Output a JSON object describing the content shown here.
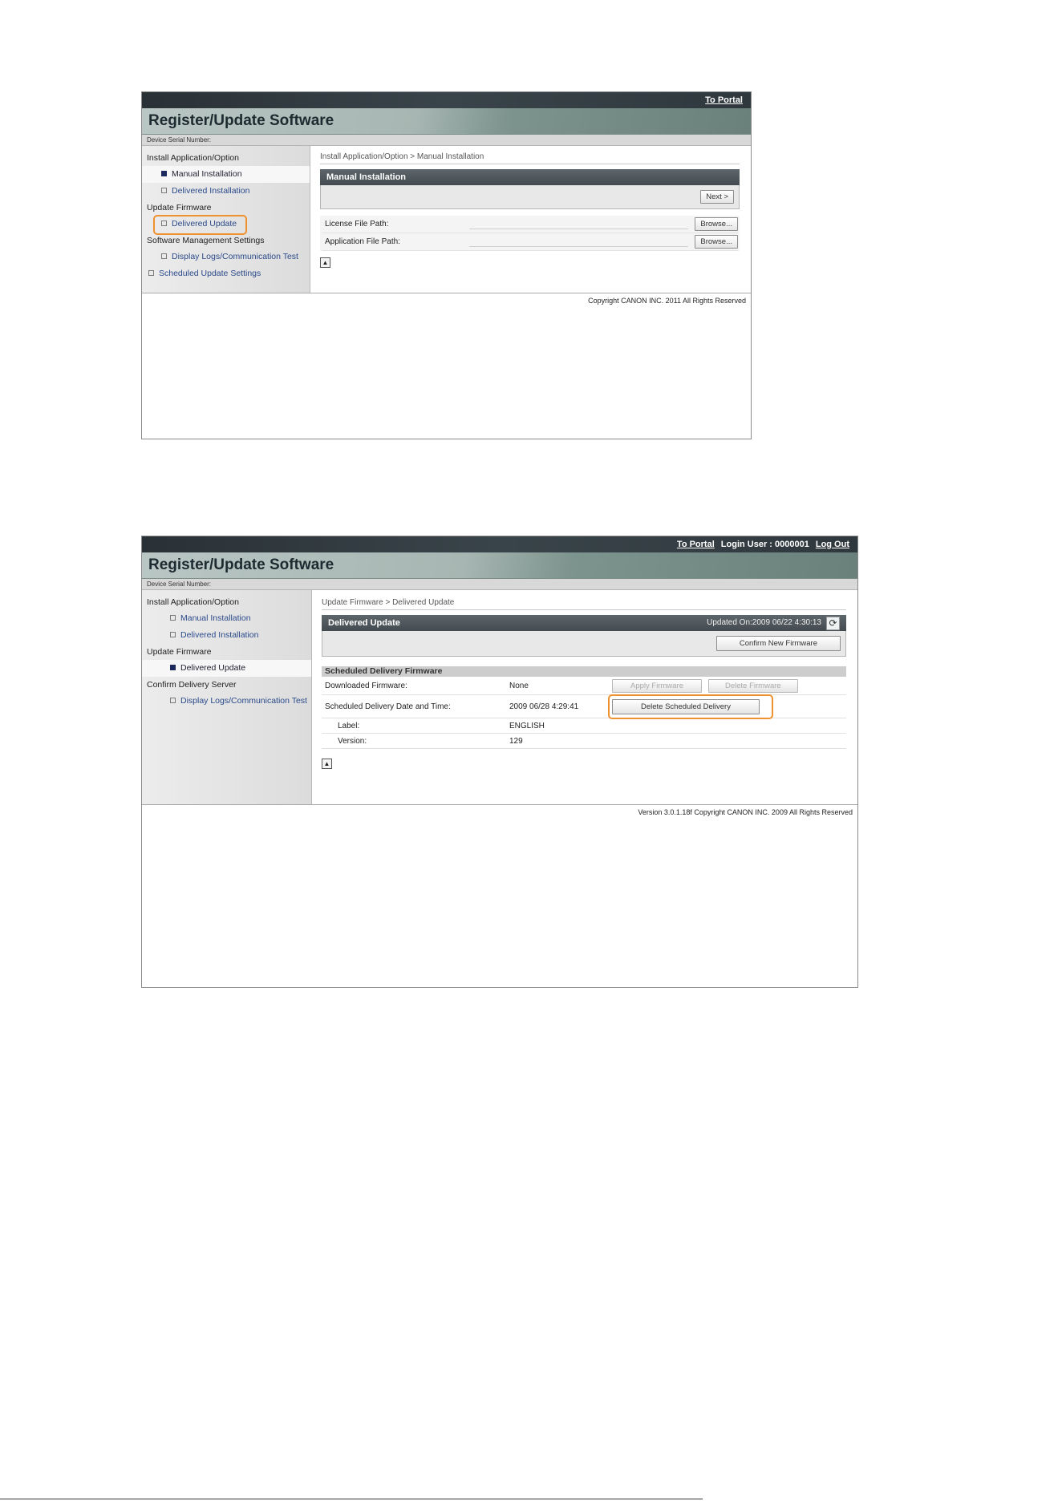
{
  "shot1": {
    "top_bar": {
      "to_portal": "To Portal"
    },
    "title": "Register/Update Software",
    "serial_label": "Device Serial Number:",
    "sidebar": {
      "install_header": "Install Application/Option",
      "manual_installation": "Manual Installation",
      "delivered_installation": "Delivered Installation",
      "update_header": "Update Firmware",
      "delivered_update": "Delivered Update",
      "software_mgmt_header": "Software Management Settings",
      "display_logs": "Display Logs/Communication Test",
      "scheduled_update_settings": "Scheduled Update Settings"
    },
    "breadcrumb": "Install Application/Option > Manual Installation",
    "panel_title": "Manual Installation",
    "next_button": "Next >",
    "fields": [
      {
        "label": "License File Path:",
        "button": "Browse..."
      },
      {
        "label": "Application File Path:",
        "button": "Browse..."
      }
    ],
    "top_icon": "▲",
    "copyright": "Copyright CANON INC. 2011 All Rights Reserved"
  },
  "shot2": {
    "top_bar": {
      "to_portal": "To Portal",
      "login_user": "Login User : 0000001",
      "log_out": "Log Out"
    },
    "title": "Register/Update Software",
    "serial_label": "Device Serial Number:",
    "sidebar": {
      "install_header": "Install Application/Option",
      "manual_installation": "Manual Installation",
      "delivered_installation": "Delivered Installation",
      "update_header": "Update Firmware",
      "delivered_update": "Delivered Update",
      "confirm_server_header": "Confirm Delivery Server",
      "display_logs": "Display Logs/Communication Test"
    },
    "breadcrumb": "Update Firmware > Delivered Update",
    "panel_title": "Delivered Update",
    "updated_on": "Updated On:2009 06/22 4:30:13",
    "refresh_icon": "⟳",
    "confirm_button": "Confirm New Firmware",
    "section_title": "Scheduled Delivery Firmware",
    "downloaded_label": "Downloaded Firmware:",
    "downloaded_value": "None",
    "apply_button": "Apply Firmware",
    "delete_firmware_button": "Delete Firmware",
    "scheduled_label": "Scheduled Delivery Date and Time:",
    "scheduled_value": "2009 06/28 4:29:41",
    "delete_scheduled_button": "Delete Scheduled Delivery",
    "label_label": "Label:",
    "label_value": "ENGLISH",
    "version_label": "Version:",
    "version_value": "129",
    "top_icon": "▲",
    "copyright": "Version 3.0.1.18f Copyright CANON INC. 2009 All Rights Reserved"
  },
  "colors": {
    "highlight": "#f0912f",
    "panel_header": "#4b5458",
    "title_band": "#a7b6b2"
  }
}
